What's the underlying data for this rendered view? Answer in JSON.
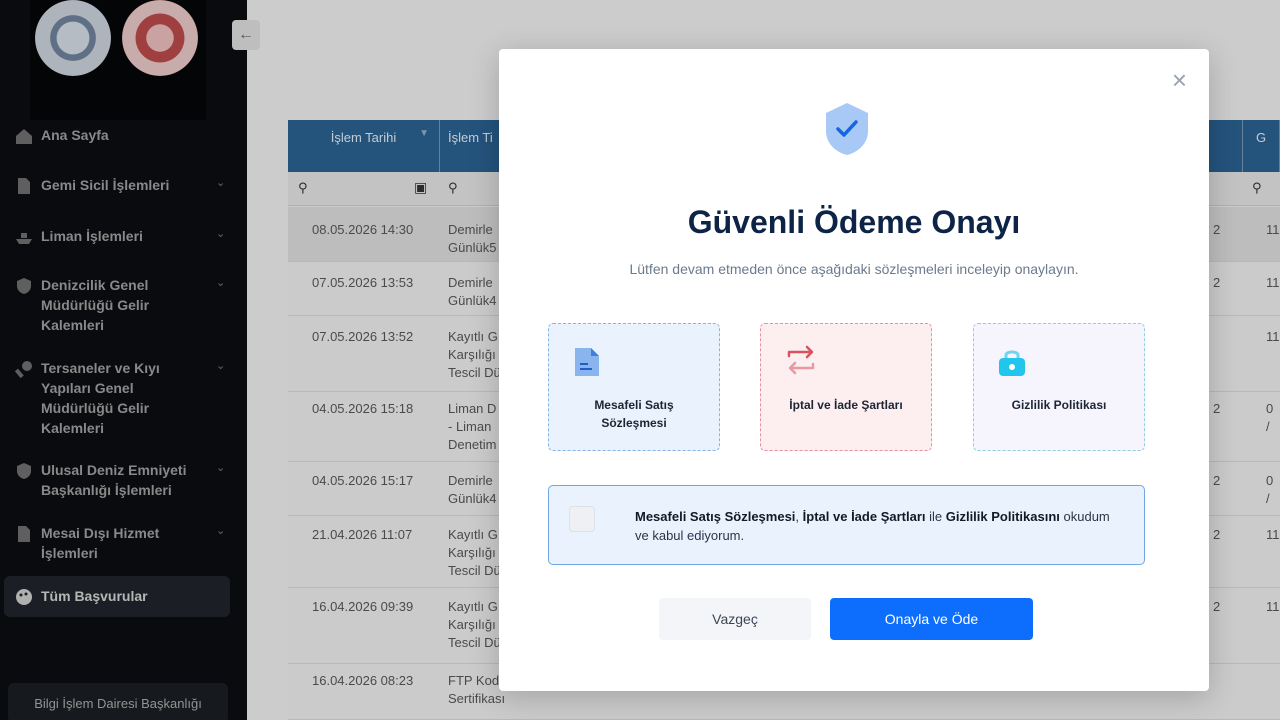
{
  "sidebar": {
    "items": [
      {
        "label": "Ana Sayfa",
        "icon": "home-icon"
      },
      {
        "label": "Gemi Sicil İşlemleri",
        "icon": "document-icon"
      },
      {
        "label": "Liman İşlemleri",
        "icon": "ship-icon"
      },
      {
        "label": "Denizcilik Genel\nMüdürlüğü Gelir\nKalemleri",
        "icon": "shield-icon"
      },
      {
        "label": "Tersaneler ve Kıyı\nYapıları Genel\nMüdürlüğü Gelir\nKalemleri",
        "icon": "wrench-icon"
      },
      {
        "label": "Ulusal Deniz Emniyeti\nBaşkanlığı İşlemleri",
        "icon": "shield-icon"
      },
      {
        "label": "Mesai Dışı Hizmet\nİşlemleri",
        "icon": "document-icon"
      },
      {
        "label": "Tüm Başvurular",
        "icon": "palette-icon"
      }
    ],
    "footer": "Bilgi İşlem Dairesi Başkanlığı",
    "collapse_icon": "←"
  },
  "table": {
    "columns": [
      "İşlem Tarihi",
      "İşlem Ti"
    ],
    "rows": [
      {
        "date": "08.05.2026 14:30",
        "type": "Demirle\nGünlük5",
        "col3": "2",
        "col4": "11"
      },
      {
        "date": "07.05.2026 13:53",
        "type": "Demirle\nGünlük4",
        "col3": "2",
        "col4": "11"
      },
      {
        "date": "07.05.2026 13:52",
        "type": "Kayıtlı G\nKarşılığı\nTescil Dü",
        "col3": "",
        "col4": "11"
      },
      {
        "date": "04.05.2026 15:18",
        "type": "Liman D\n- Liman\nDenetim",
        "col3": "2",
        "col4": "0 /"
      },
      {
        "date": "04.05.2026 15:17",
        "type": "Demirle\nGünlük4",
        "col3": "2",
        "col4": "0 /"
      },
      {
        "date": "21.04.2026 11:07",
        "type": "Kayıtlı G\nKarşılığı\nTescil Dü",
        "col3": "2",
        "col4": "11"
      },
      {
        "date": "16.04.2026 09:39",
        "type": "Kayıtlı G\nKarşılığı\nTescil Dü",
        "col3": "2",
        "col4": "11"
      },
      {
        "date": "16.04.2026 08:23",
        "type": "FTP Kod\nSertifikası",
        "col3": "",
        "col4": ""
      }
    ],
    "header_partial": "G"
  },
  "modal": {
    "close_label": "×",
    "title": "Güvenli Ödeme Onayı",
    "subtitle": "Lütfen devam etmeden önce aşağıdaki sözleşmeleri inceleyip onaylayın.",
    "cards": [
      {
        "label": "Mesafeli Satış\nSözleşmesi",
        "icon": "file-icon"
      },
      {
        "label": "İptal ve İade Şartları",
        "icon": "exchange-icon"
      },
      {
        "label": "Gizlilik Politikası",
        "icon": "lock-icon"
      }
    ],
    "consent": {
      "part1": "Mesafeli Satış Sözleşmesi",
      "sep1": ", ",
      "part2": "İptal ve İade Şartları",
      "sep2": " ile ",
      "part3": "Gizlilik Politikasını",
      "tail": " okudum ve kabul ediyorum."
    },
    "cancel_label": "Vazgeç",
    "confirm_label": "Onayla ve Öde"
  },
  "colors": {
    "primary": "#0d6efd",
    "title": "#0d2447",
    "table_header": "#2a5f8e",
    "sidebar_bg": "#0b0d10"
  }
}
